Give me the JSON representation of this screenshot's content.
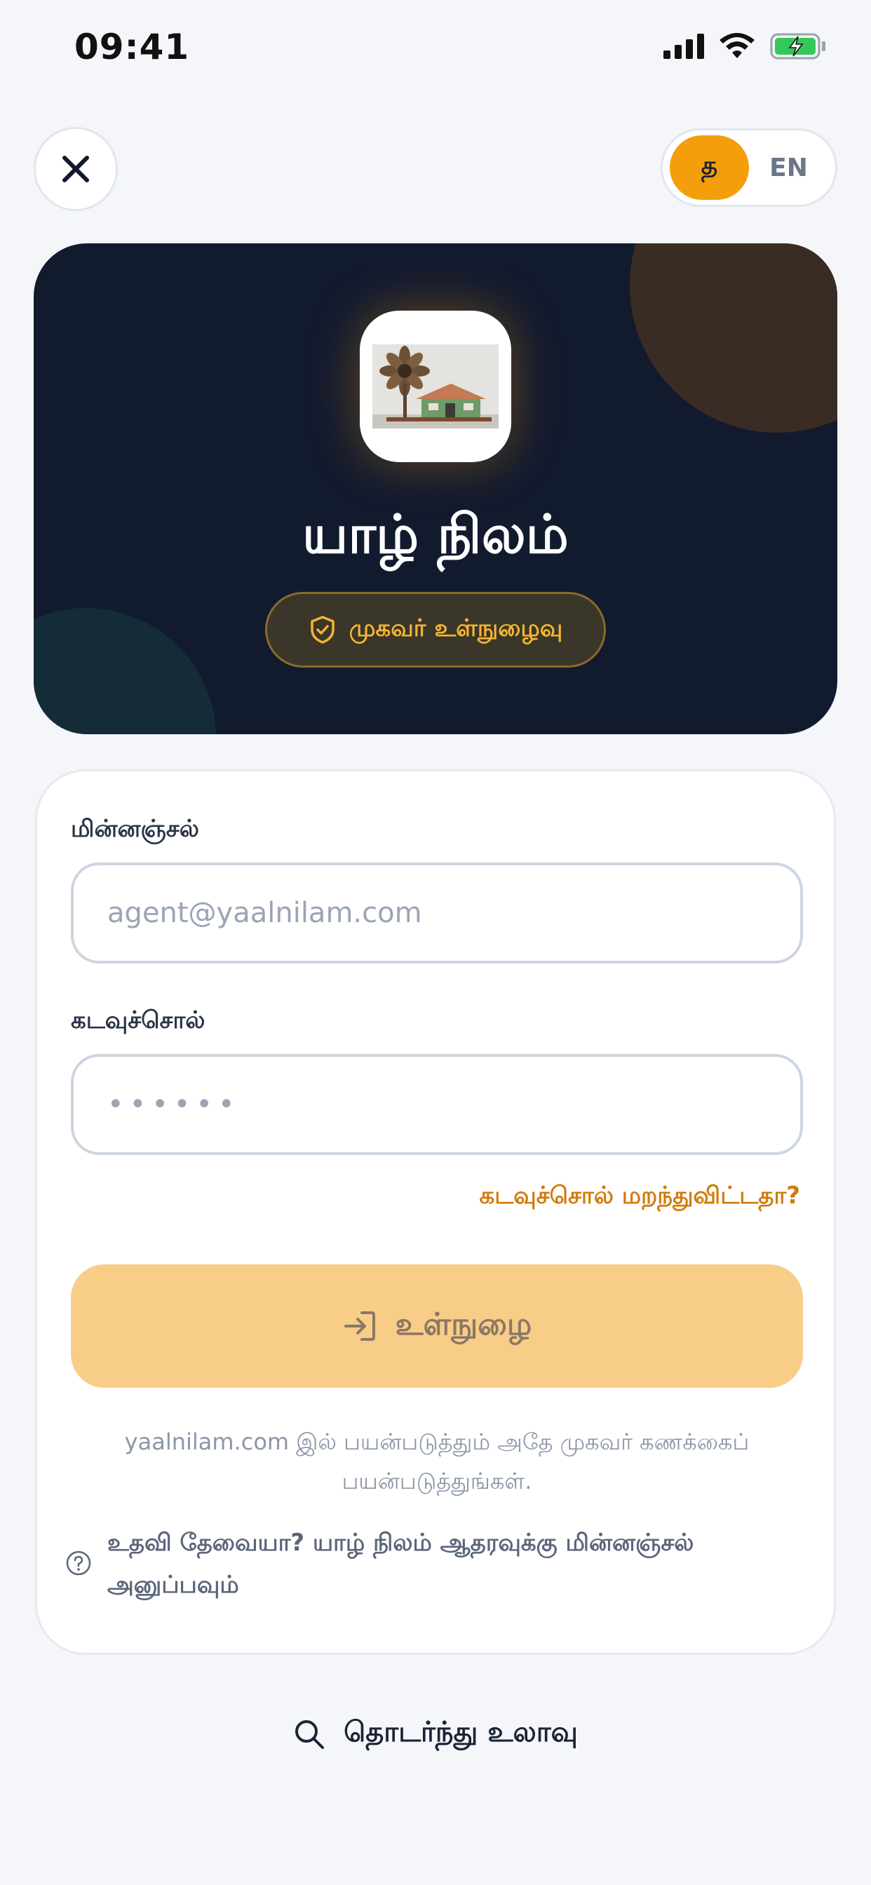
{
  "status_bar": {
    "time": "09:41"
  },
  "language": {
    "tamil_label": "த",
    "english_label": "EN",
    "active": "ta"
  },
  "hero": {
    "app_name": "யாழ் நிலம்",
    "badge_label": "முகவர் உள்நுழைவு"
  },
  "form": {
    "email_label": "மின்னஞ்சல்",
    "email_placeholder": "agent@yaalnilam.com",
    "password_label": "கடவுச்சொல்",
    "password_placeholder": "••••••",
    "forgot_label": "கடவுச்சொல் மறந்துவிட்டதா?",
    "login_label": "உள்நுழை",
    "info_text": "yaalnilam.com இல் பயன்படுத்தும் அதே முகவர் கணக்கைப் பயன்படுத்துங்கள்.",
    "help_text": "உதவி தேவையா? யாழ் நிலம் ஆதரவுக்கு மின்னஞ்சல் அனுப்பவும்"
  },
  "browse": {
    "label": "தொடர்ந்து உலாவு"
  },
  "icons": {
    "close": "close-icon",
    "shield": "shield-check-icon",
    "login": "login-icon",
    "help": "help-circle-icon",
    "search": "search-icon"
  },
  "colors": {
    "accent": "#f59e0b",
    "hero_bg": "#121a2e",
    "link": "#d27a0a",
    "button_disabled": "#f8cd87"
  }
}
